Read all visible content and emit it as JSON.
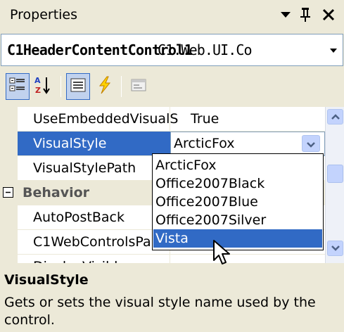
{
  "window": {
    "title": "Properties",
    "buttons": {
      "dropdown": "▾",
      "pin": "pin-icon",
      "close": "✕"
    }
  },
  "selector": {
    "name": "C1HeaderContentControl1",
    "type": "C1.Web.UI.Co"
  },
  "toolbar": {
    "buttons": [
      "categorized-icon",
      "alphabetical-icon",
      "properties-icon",
      "events-icon",
      "property-pages-icon"
    ]
  },
  "grid": {
    "rows": [
      {
        "name": "UseEmbeddedVisualS",
        "value": "True"
      },
      {
        "name": "VisualStyle",
        "value": "ArcticFox",
        "selected": true
      },
      {
        "name": "VisualStylePath",
        "value": ""
      },
      {
        "name": "Behavior",
        "category": true
      },
      {
        "name": "AutoPostBack",
        "value": ""
      },
      {
        "name": "C1WebControlsPa",
        "value": ""
      },
      {
        "name": "DisplayVisible",
        "value": ""
      }
    ],
    "category_toggle": "⊟"
  },
  "dropdown": {
    "options": [
      "ArcticFox",
      "Office2007Black",
      "Office2007Blue",
      "Office2007Silver",
      "Vista"
    ],
    "highlighted": "Vista"
  },
  "help": {
    "title": "VisualStyle",
    "description": "Gets or sets the visual style name used by the control."
  },
  "colors": {
    "selection": "#316ac5",
    "chrome": "#ece9d8"
  }
}
